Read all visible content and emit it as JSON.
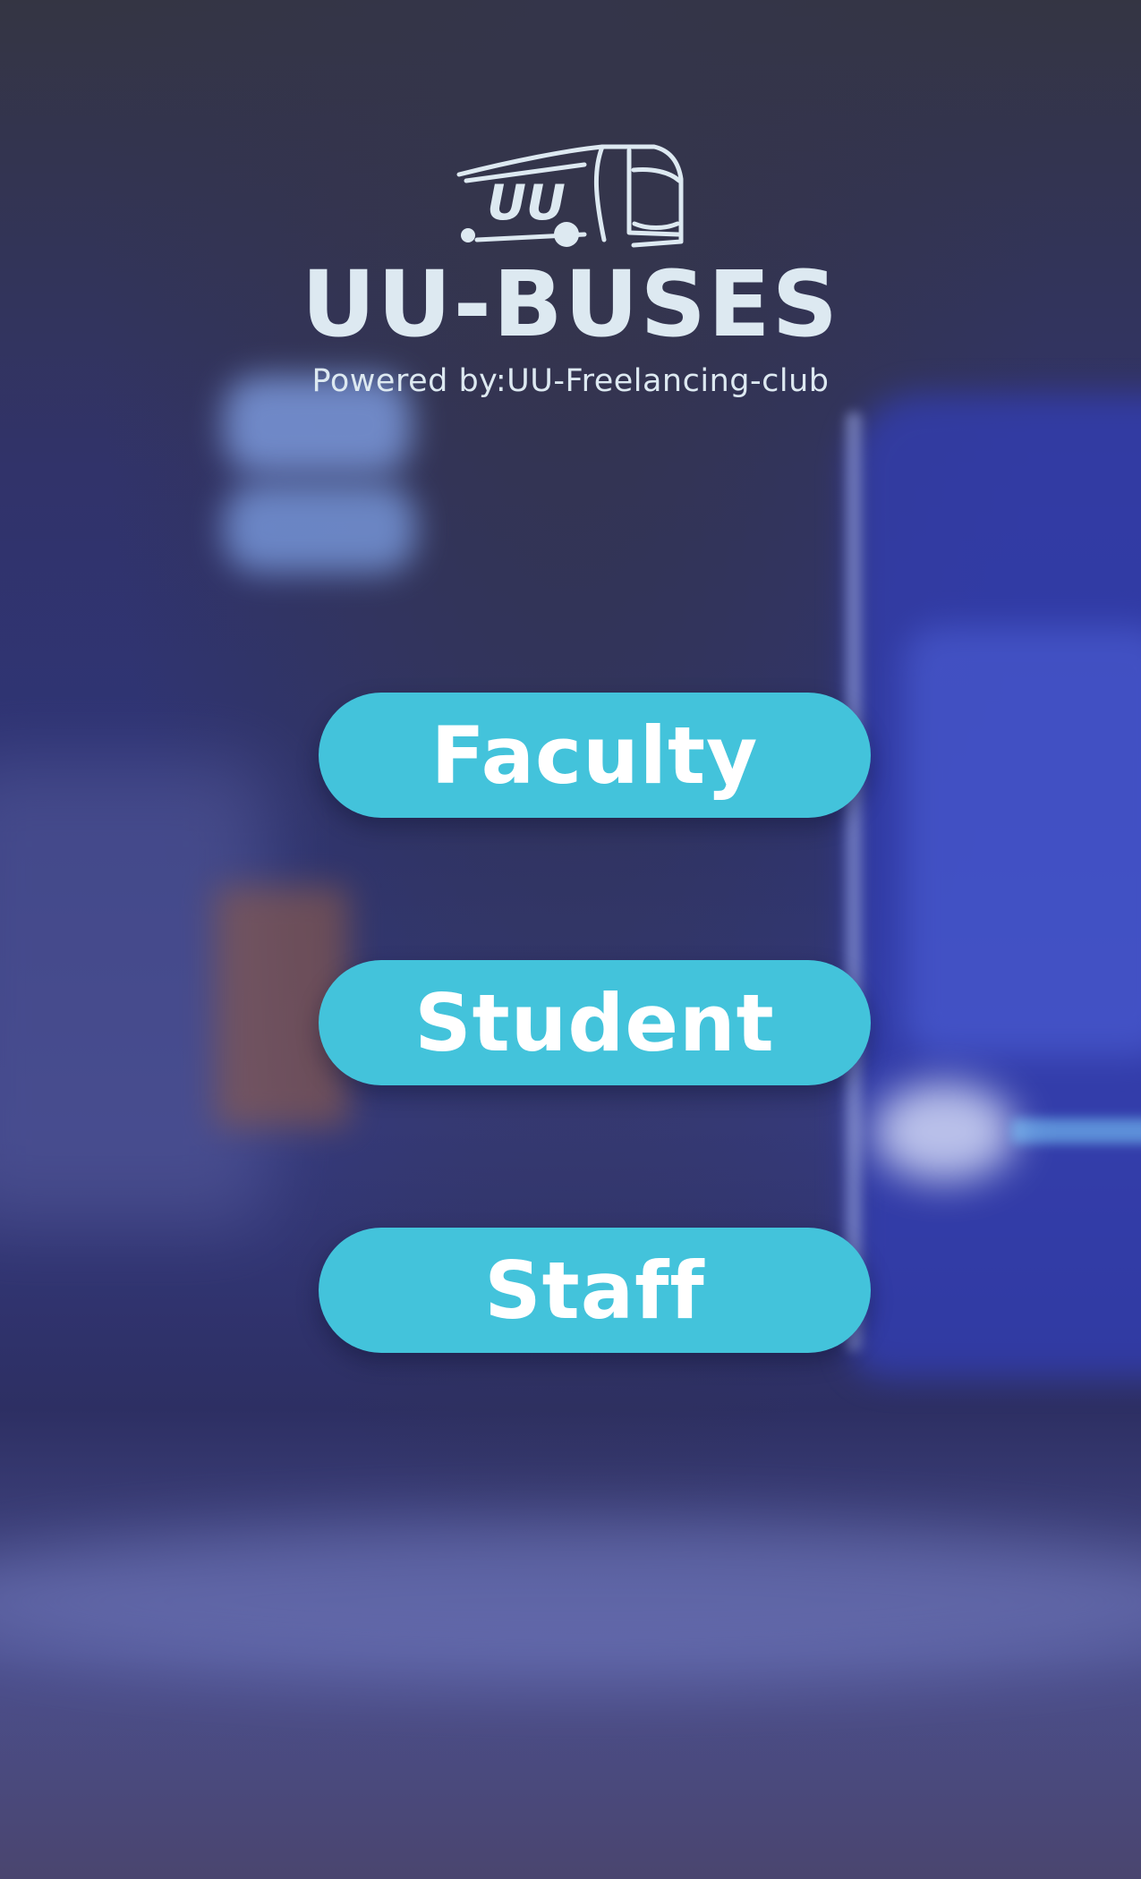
{
  "brand": {
    "logo_badge": "UU",
    "title": "UU-BUSES",
    "subtitle": "Powered by:UU-Freelancing-club"
  },
  "menu": {
    "buttons": [
      {
        "label": "Faculty"
      },
      {
        "label": "Student"
      },
      {
        "label": "Staff"
      }
    ]
  },
  "colors": {
    "button": "#43c3db",
    "button_text": "#ffffff",
    "brand_text": "#dde9f1"
  }
}
